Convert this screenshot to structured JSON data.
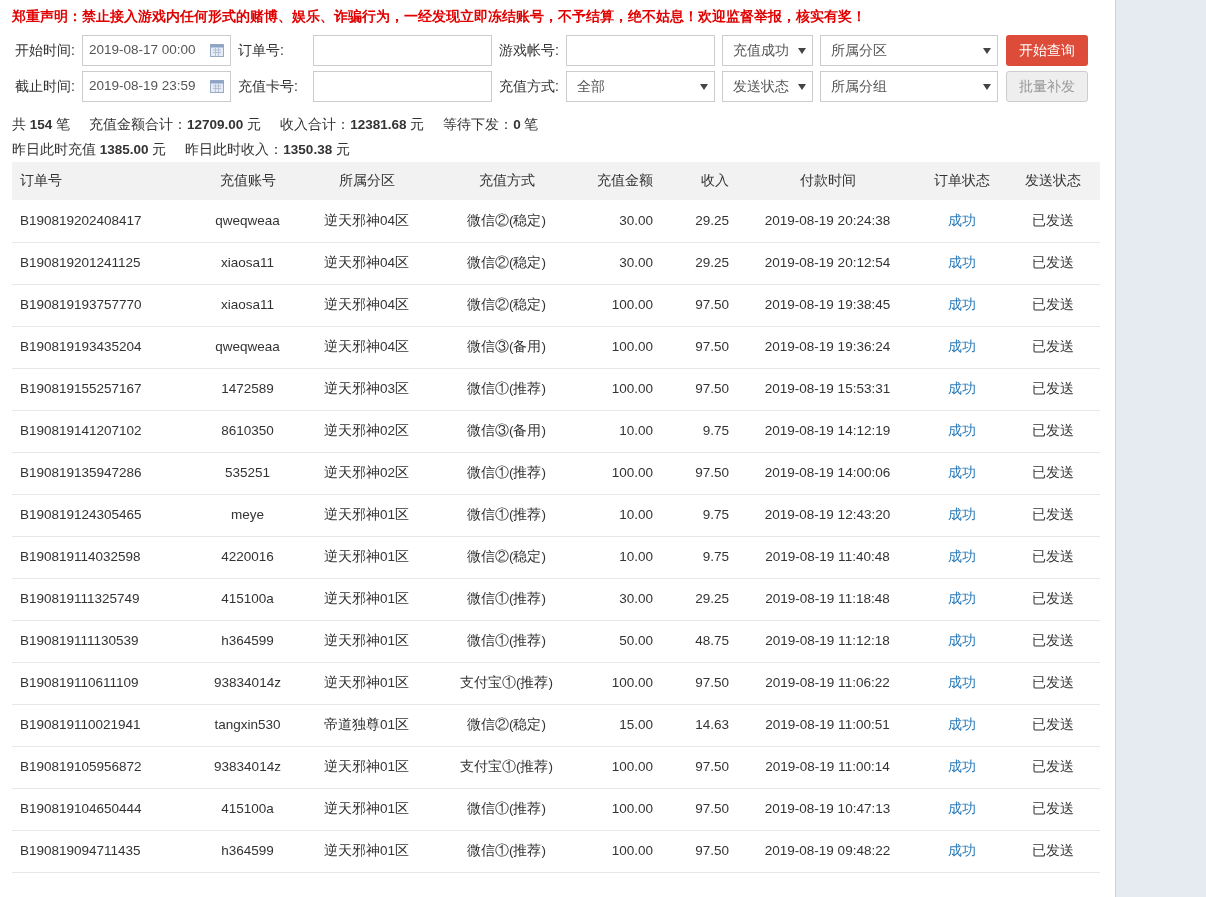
{
  "notice": "郑重声明：禁止接入游戏内任何形式的赌博、娱乐、诈骗行为，一经发现立即冻结账号，不予结算，绝不姑息！欢迎监督举报，核实有奖！",
  "filter_rows": [
    [
      {
        "kind": "label",
        "text": "开始时间:"
      },
      {
        "kind": "date",
        "value": "2019-08-17 00:00"
      },
      {
        "kind": "label",
        "text": "订单号:"
      },
      {
        "kind": "text"
      },
      {
        "kind": "label",
        "text": "游戏帐号:"
      },
      {
        "kind": "text"
      },
      {
        "kind": "select",
        "value": "充值成功"
      },
      {
        "kind": "select",
        "value": "所属分区"
      },
      {
        "kind": "button",
        "text": "开始查询",
        "disabled": false
      }
    ],
    [
      {
        "kind": "label",
        "text": "截止时间:"
      },
      {
        "kind": "date",
        "value": "2019-08-19 23:59"
      },
      {
        "kind": "label",
        "text": "充值卡号:"
      },
      {
        "kind": "text"
      },
      {
        "kind": "label",
        "text": "充值方式:"
      },
      {
        "kind": "select",
        "value": "全部"
      },
      {
        "kind": "select",
        "value": "发送状态"
      },
      {
        "kind": "select",
        "value": "所属分组"
      },
      {
        "kind": "button",
        "text": "批量补发",
        "disabled": true
      }
    ]
  ],
  "summary": [
    [
      "共 **154** 笔",
      "充值金额合计：**12709.00** 元",
      "收入合计：**12381.68** 元",
      "等待下发：**0** 笔"
    ],
    [
      "昨日此时充值 **1385.00** 元",
      "昨日此时收入：**1350.38** 元"
    ]
  ],
  "table": {
    "columns": [
      "订单号",
      "充值账号",
      "所属分区",
      "充值方式",
      "充值金额",
      "收入",
      "付款时间",
      "订单状态",
      "发送状态"
    ],
    "rows": [
      [
        "B190819202408417",
        "qweqweaa",
        "逆天邪神04区",
        "微信②(稳定)",
        "30.00",
        "29.25",
        "2019-08-19 20:24:38",
        "成功",
        "已发送"
      ],
      [
        "B190819201241125",
        "xiaosa11",
        "逆天邪神04区",
        "微信②(稳定)",
        "30.00",
        "29.25",
        "2019-08-19 20:12:54",
        "成功",
        "已发送"
      ],
      [
        "B190819193757770",
        "xiaosa11",
        "逆天邪神04区",
        "微信②(稳定)",
        "100.00",
        "97.50",
        "2019-08-19 19:38:45",
        "成功",
        "已发送"
      ],
      [
        "B190819193435204",
        "qweqweaa",
        "逆天邪神04区",
        "微信③(备用)",
        "100.00",
        "97.50",
        "2019-08-19 19:36:24",
        "成功",
        "已发送"
      ],
      [
        "B190819155257167",
        "1472589",
        "逆天邪神03区",
        "微信①(推荐)",
        "100.00",
        "97.50",
        "2019-08-19 15:53:31",
        "成功",
        "已发送"
      ],
      [
        "B190819141207102",
        "8610350",
        "逆天邪神02区",
        "微信③(备用)",
        "10.00",
        "9.75",
        "2019-08-19 14:12:19",
        "成功",
        "已发送"
      ],
      [
        "B190819135947286",
        "535251",
        "逆天邪神02区",
        "微信①(推荐)",
        "100.00",
        "97.50",
        "2019-08-19 14:00:06",
        "成功",
        "已发送"
      ],
      [
        "B190819124305465",
        "meye",
        "逆天邪神01区",
        "微信①(推荐)",
        "10.00",
        "9.75",
        "2019-08-19 12:43:20",
        "成功",
        "已发送"
      ],
      [
        "B190819114032598",
        "4220016",
        "逆天邪神01区",
        "微信②(稳定)",
        "10.00",
        "9.75",
        "2019-08-19 11:40:48",
        "成功",
        "已发送"
      ],
      [
        "B190819111325749",
        "415100a",
        "逆天邪神01区",
        "微信①(推荐)",
        "30.00",
        "29.25",
        "2019-08-19 11:18:48",
        "成功",
        "已发送"
      ],
      [
        "B190819111130539",
        "h364599",
        "逆天邪神01区",
        "微信①(推荐)",
        "50.00",
        "48.75",
        "2019-08-19 11:12:18",
        "成功",
        "已发送"
      ],
      [
        "B190819110611109",
        "93834014z",
        "逆天邪神01区",
        "支付宝①(推荐)",
        "100.00",
        "97.50",
        "2019-08-19 11:06:22",
        "成功",
        "已发送"
      ],
      [
        "B190819110021941",
        "tangxin530",
        "帝道独尊01区",
        "微信②(稳定)",
        "15.00",
        "14.63",
        "2019-08-19 11:00:51",
        "成功",
        "已发送"
      ],
      [
        "B190819105956872",
        "93834014z",
        "逆天邪神01区",
        "支付宝①(推荐)",
        "100.00",
        "97.50",
        "2019-08-19 11:00:14",
        "成功",
        "已发送"
      ],
      [
        "B190819104650444",
        "415100a",
        "逆天邪神01区",
        "微信①(推荐)",
        "100.00",
        "97.50",
        "2019-08-19 10:47:13",
        "成功",
        "已发送"
      ],
      [
        "B190819094711435",
        "h364599",
        "逆天邪神01区",
        "微信①(推荐)",
        "100.00",
        "97.50",
        "2019-08-19 09:48:22",
        "成功",
        "已发送"
      ]
    ]
  }
}
